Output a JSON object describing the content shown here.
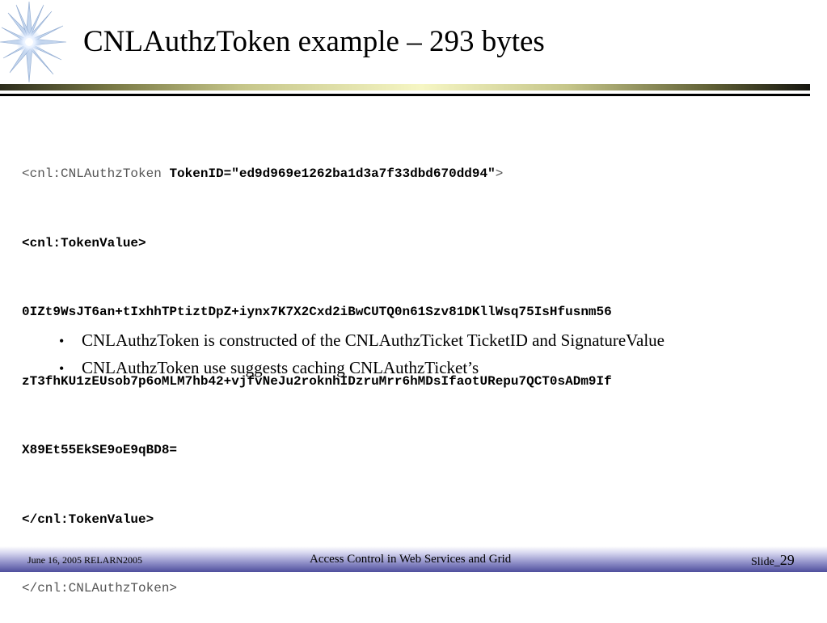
{
  "slide": {
    "title": "CNLAuthzToken example – 293 bytes"
  },
  "code": {
    "open_tag_start": "<cnl:CNLAuthzToken ",
    "token_attr": "TokenID=\"ed9d969e1262ba1d3a7f33dbd670dd94\"",
    "open_tag_end": ">",
    "value_open": "<cnl:TokenValue>",
    "value_line1": "0IZt9WsJT6an+tIxhhTPtiztDpZ+iynx7K7X2Cxd2iBwCUTQ0n61Szv81DKllWsq75IsHfusnm56",
    "value_line2": "zT3fhKU1zEUsob7p6oMLM7hb42+vjfvNeJu2roknhIDzruMrr6hMDsIfaotURepu7QCT0sADm9If",
    "value_line3": "X89Et55EkSE9oE9qBD8=",
    "value_close": "</cnl:TokenValue>",
    "close_tag": "</cnl:CNLAuthzToken>"
  },
  "bullets": [
    "CNLAuthzToken is constructed of the CNLAuthzTicket TicketID and SignatureValue",
    "CNLAuthzToken use suggests caching CNLAuthzTicket’s"
  ],
  "footer": {
    "date": "June 16, 2005 RELARN2005",
    "center": "Access Control in Web Services and Grid",
    "slide_label": "Slide_",
    "slide_number": "29"
  },
  "icons": {
    "logo": "starburst-logo"
  },
  "colors": {
    "footer_band": "#4e4e9c",
    "title_bar_highlight": "#f6f6c4"
  }
}
